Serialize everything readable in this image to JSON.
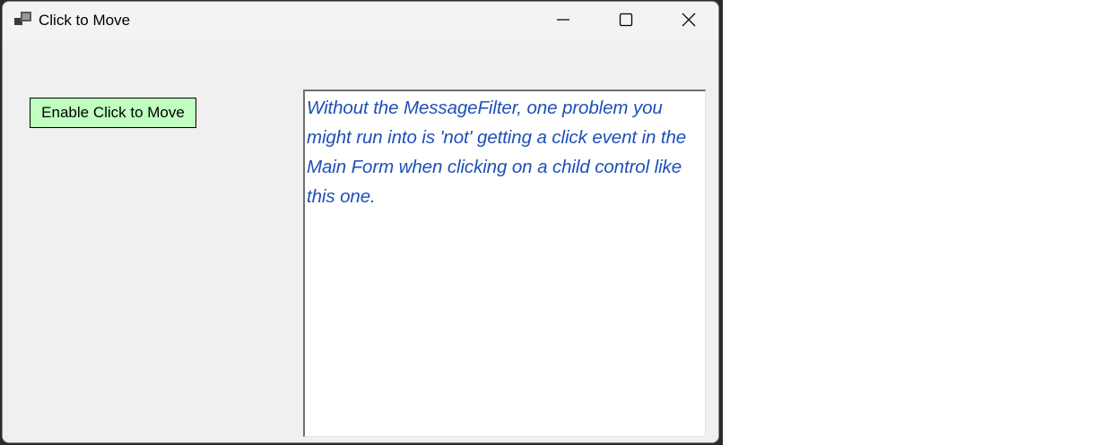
{
  "window": {
    "title": "Click to Move"
  },
  "controls": {
    "enable_button_label": "Enable Click to Move"
  },
  "textbox": {
    "text": "Without the MessageFilter, one problem you might run into is 'not' getting a click event in the Main Form when clicking on a child control like this one."
  },
  "colors": {
    "button_bg": "#c0ffc0",
    "text_color": "#1d4fb8",
    "window_bg": "#f0f0f0"
  }
}
